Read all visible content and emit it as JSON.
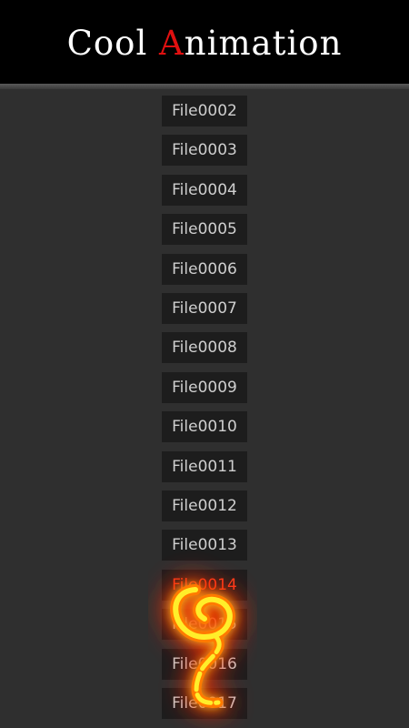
{
  "header": {
    "title_prefix": "Cool ",
    "title_accent": "A",
    "title_suffix": "nimation"
  },
  "files": [
    "File0002",
    "File0003",
    "File0004",
    "File0005",
    "File0006",
    "File0007",
    "File0008",
    "File0009",
    "File0010",
    "File0011",
    "File0012",
    "File0013",
    "File0014",
    "File0015",
    "File0016",
    "File0017"
  ],
  "active_file": "File0014",
  "colors": {
    "background": "#2f2f2f",
    "header": "#000000",
    "title_text": "#ffffff",
    "title_accent": "#e01010",
    "item_background": "#1d1d1d",
    "item_text": "#cfcfcf",
    "active_text": "#ff3d1e"
  },
  "effects": {
    "overlay": "fire-swirl"
  }
}
